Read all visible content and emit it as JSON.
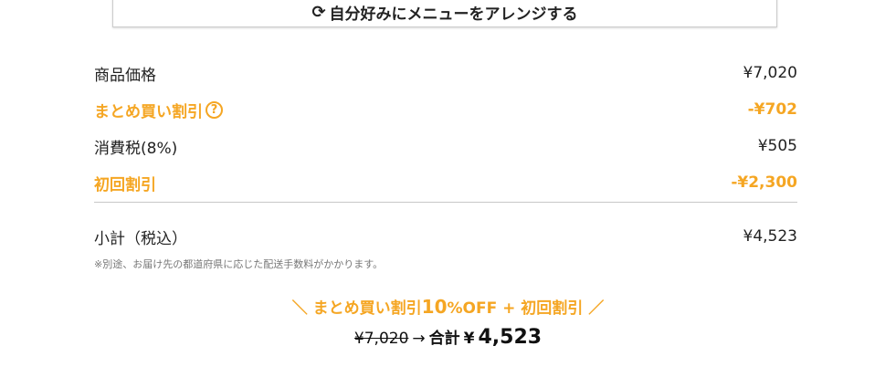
{
  "top_button": {
    "icon": "refresh-icon",
    "label": "自分好みにメニューをアレンジする"
  },
  "summary": {
    "product_price_label": "商品価格",
    "product_price_value": "¥7,020",
    "bulk_discount_label": "まとめ買い割引",
    "bulk_discount_help": "?",
    "bulk_discount_value": "-¥702",
    "tax_label": "消費税(8%)",
    "tax_value": "¥505",
    "first_discount_label": "初回割引",
    "first_discount_value": "-¥2,300",
    "subtotal_label": "小計（税込）",
    "subtotal_value": "¥4,523",
    "shipping_note": "※別途、お届け先の都道府県に応じた配送手数料がかかります。"
  },
  "promo": {
    "left_slash": "＼",
    "text_prefix": "まとめ買い割引",
    "text_percent": "10",
    "text_suffix": "%OFF + 初回割引",
    "right_slash": "／"
  },
  "total": {
    "original": "¥7,020",
    "arrow": "→",
    "label": "合計",
    "currency": "¥",
    "amount": "4,523"
  },
  "colors": {
    "accent": "#f5a623",
    "divider": "#c8c8c8",
    "note": "#777777"
  }
}
